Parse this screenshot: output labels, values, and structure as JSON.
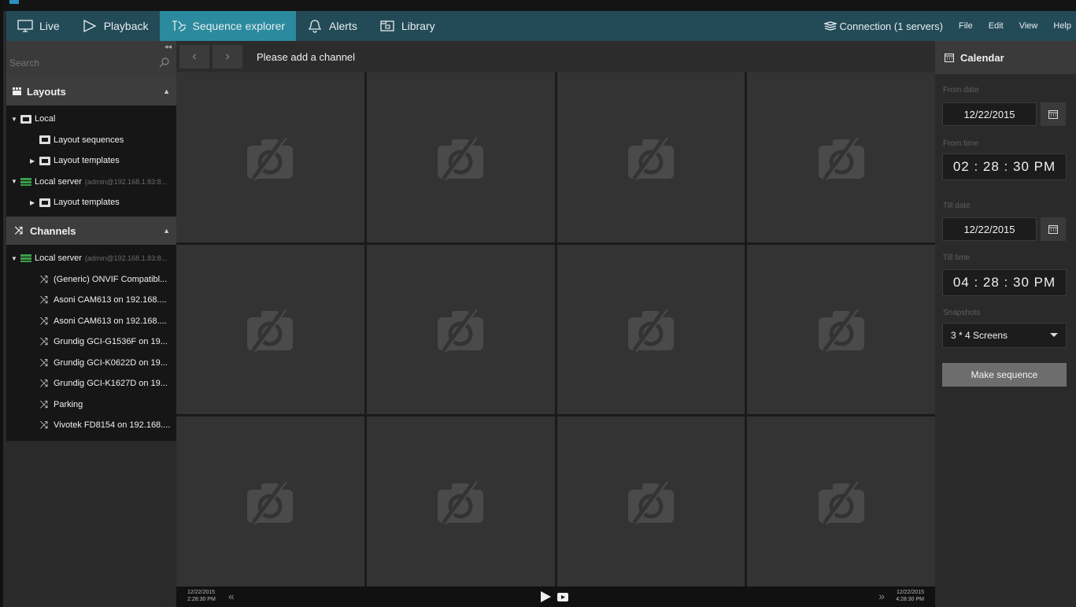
{
  "menubar": {
    "tabs": [
      {
        "label": "Live",
        "icon": "monitor-icon"
      },
      {
        "label": "Playback",
        "icon": "play-icon"
      },
      {
        "label": "Sequence explorer",
        "icon": "sequence-icon",
        "active": true
      },
      {
        "label": "Alerts",
        "icon": "bell-icon"
      },
      {
        "label": "Library",
        "icon": "library-icon"
      }
    ],
    "connection": "Connection (1 servers)",
    "menu": [
      "File",
      "Edit",
      "View",
      "Help"
    ],
    "accent_color": "#2b8a9e",
    "bar_color": "#234a57"
  },
  "left_panel": {
    "search_placeholder": "Search",
    "layouts": {
      "title": "Layouts",
      "items": [
        {
          "label": "Local",
          "level": 0,
          "expanded": true
        },
        {
          "label": "Layout sequences",
          "level": 1
        },
        {
          "label": "Layout templates",
          "level": 1,
          "expandable": true
        },
        {
          "label": "Local server",
          "muted": "(admin@192.168.1.83:8...",
          "level": 0,
          "expanded": true
        },
        {
          "label": "Layout templates",
          "level": 1,
          "expandable": true
        }
      ]
    },
    "channels": {
      "title": "Channels",
      "server": {
        "label": "Local server",
        "muted": "(admin@192.168.1.83:8..."
      },
      "items": [
        "(Generic) ONVIF Compatibl...",
        "Asoni CAM613 on 192.168....",
        "Asoni CAM613 on 192.168....",
        "Grundig GCI-G1536F on 19...",
        "Grundig GCI-K0622D on 19...",
        "Grundig GCI-K1627D on 19...",
        "Parking",
        "Vivotek FD8154 on 192.168...."
      ]
    }
  },
  "center": {
    "message": "Please add a channel",
    "grid": {
      "rows": 3,
      "cols": 4,
      "cell_icon": "no-camera-icon"
    },
    "timeline": {
      "start_date": "12/22/2015",
      "start_time": "2:28:30 PM",
      "end_date": "12/22/2015",
      "end_time": "4:28:30 PM"
    }
  },
  "right_panel": {
    "title": "Calendar",
    "from_date_label": "From date",
    "from_date": "12/22/2015",
    "from_time_label": "From time",
    "from_time": "02 : 28 : 30  PM",
    "till_date_label": "Till date",
    "till_date": "12/22/2015",
    "till_time_label": "Till time",
    "till_time": "04 : 28 : 30  PM",
    "snapshots_label": "Snapshots",
    "snapshots_value": "3 * 4 Screens",
    "make_button": "Make sequence"
  }
}
